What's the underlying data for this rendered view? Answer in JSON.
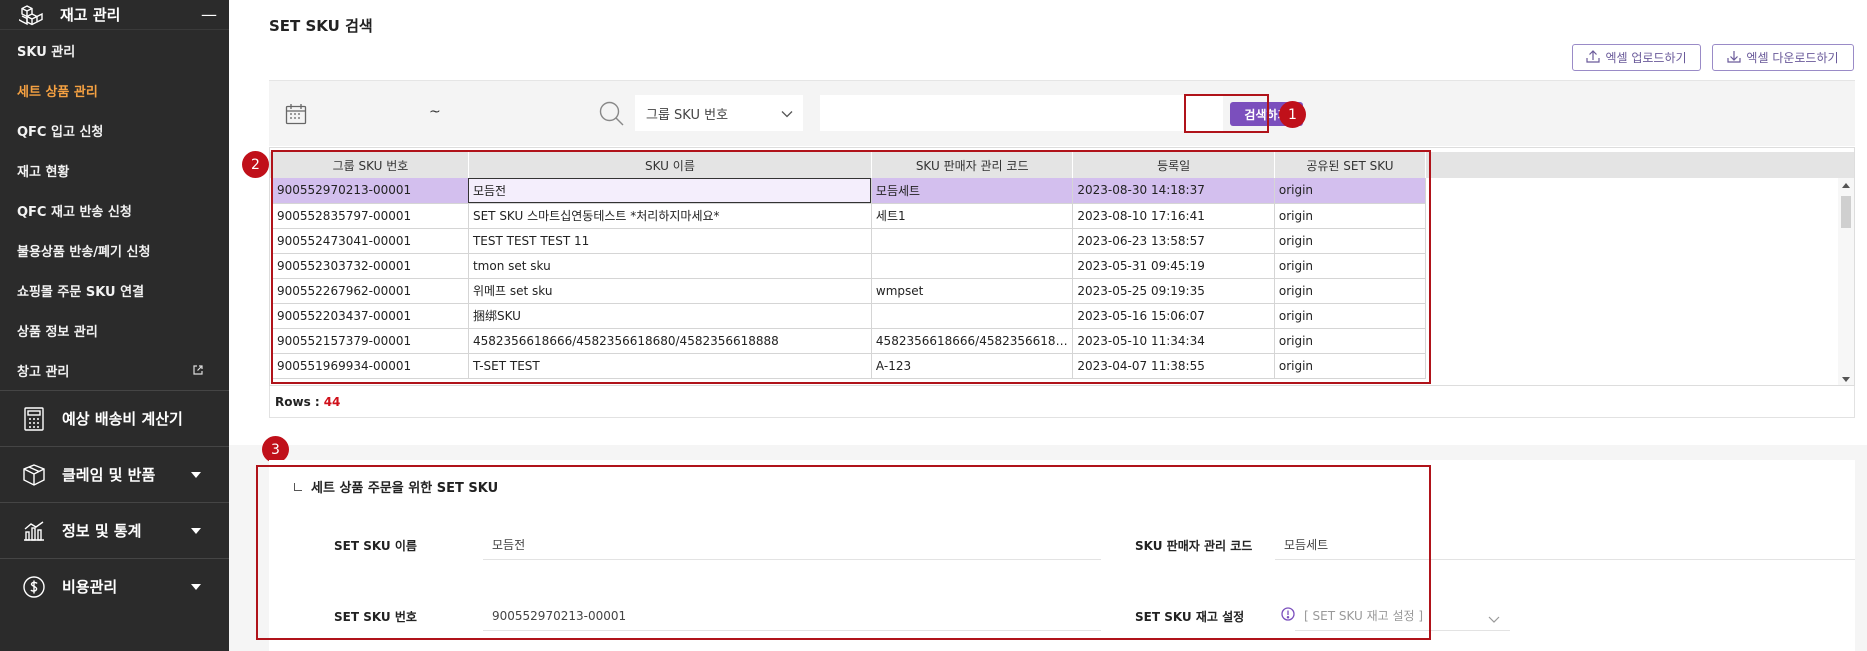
{
  "sidebar": {
    "section_title": "재고 관리",
    "sub_items": [
      {
        "label": "SKU 관리"
      },
      {
        "label": "세트 상품 관리"
      },
      {
        "label": "QFC 입고 신청"
      },
      {
        "label": "재고 현황"
      },
      {
        "label": "QFC 재고 반송 신청"
      },
      {
        "label": "불용상품 반송/폐기 신청"
      },
      {
        "label": "쇼핑몰 주문 SKU 연결"
      },
      {
        "label": "상품 정보 관리"
      },
      {
        "label": "창고 관리"
      }
    ],
    "groups": [
      {
        "label": "예상 배송비 계산기"
      },
      {
        "label": "클레임 및 반품"
      },
      {
        "label": "정보 및 통계"
      },
      {
        "label": "비용관리"
      }
    ]
  },
  "page": {
    "title": "SET SKU 검색",
    "excel_upload": "엑셀 업로드하기",
    "excel_download": "엑셀 다운로드하기"
  },
  "search": {
    "tilde": "~",
    "select_value": "그룹 SKU 번호",
    "input_value": "",
    "button": "검색하기"
  },
  "annotations": {
    "one": "1",
    "two": "2",
    "three": "3"
  },
  "table": {
    "columns": [
      "그룹 SKU 번호",
      "SKU 이름",
      "SKU 판매자 관리 코드",
      "등록일",
      "공유된 SET SKU"
    ],
    "rows": [
      [
        "900552970213-00001",
        "모듬전",
        "모듬세트",
        "2023-08-30 14:18:37",
        "origin"
      ],
      [
        "900552835797-00001",
        "SET SKU 스마트십연동테스트 *처리하지마세요*",
        "세트1",
        "2023-08-10 17:16:41",
        "origin"
      ],
      [
        "900552473041-00001",
        "TEST TEST TEST 11",
        "",
        "2023-06-23 13:58:57",
        "origin"
      ],
      [
        "900552303732-00001",
        "tmon set sku",
        "",
        "2023-05-31 09:45:19",
        "origin"
      ],
      [
        "900552267962-00001",
        "위메프 set sku",
        "wmpset",
        "2023-05-25 09:19:35",
        "origin"
      ],
      [
        "900552203437-00001",
        "捆绑SKU",
        "",
        "2023-05-16 15:06:07",
        "origin"
      ],
      [
        "900552157379-00001",
        "4582356618666/4582356618680/4582356618888",
        "4582356618666/45823566186…",
        "2023-05-10 11:34:34",
        "origin"
      ],
      [
        "900551969934-00001",
        "T-SET TEST",
        "A-123",
        "2023-04-07 11:38:55",
        "origin"
      ]
    ],
    "rows_label": "Rows :",
    "rows_count": "44"
  },
  "detail": {
    "title": "세트 상품 주문을 위한 SET SKU",
    "name_label": "SET SKU 이름",
    "name_value": "모듬전",
    "code_label": "SKU 판매자 관리 코드",
    "code_value": "모듬세트",
    "number_label": "SET SKU 번호",
    "number_value": "900552970213-00001",
    "stock_label": "SET SKU 재고 설정",
    "stock_placeholder": "[ SET SKU 재고 설정 ]"
  },
  "colors": {
    "accent": "#7b4fbd",
    "selected_row": "#d3bfee",
    "sidebar_bg": "#2b2b2b",
    "sidebar_active": "#f5a142",
    "highlight_red": "#b0131a"
  }
}
